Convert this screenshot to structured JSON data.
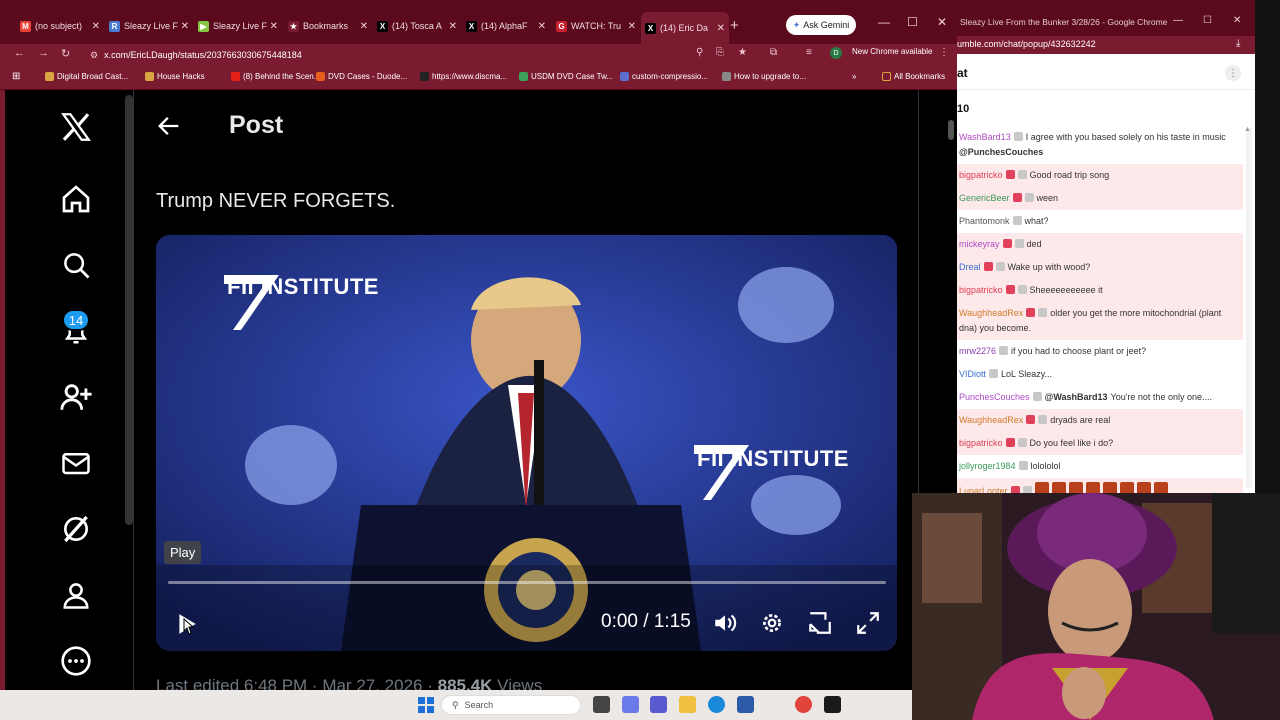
{
  "browser": {
    "tabs": [
      {
        "label": "(no subject)",
        "color": "#ea4335",
        "glyph": "M"
      },
      {
        "label": "Sleazy Live F",
        "color": "#4a7bd0",
        "glyph": "R"
      },
      {
        "label": "Sleazy Live F",
        "color": "#85c742",
        "glyph": "▶"
      },
      {
        "label": "Bookmarks",
        "color": "#7a1b2f",
        "glyph": "★"
      },
      {
        "label": "(14) Tosca A",
        "color": "#000000",
        "glyph": "X"
      },
      {
        "label": "(14) AlphaF",
        "color": "#000000",
        "glyph": "X"
      },
      {
        "label": "WATCH: Tru",
        "color": "#c6202e",
        "glyph": "G"
      },
      {
        "label": "(14) Eric Da",
        "color": "#000000",
        "glyph": "X"
      }
    ],
    "new_tab": "+",
    "gemini_label": "Ask Gemini",
    "url": "x.com/EricLDaugh/status/2037663030675448184",
    "new_chrome": "New Chrome available",
    "profile": "D",
    "bookmarks": [
      {
        "label": "Digital Broad Cast...",
        "color": "#d9a441"
      },
      {
        "label": "House Hacks",
        "color": "#d9a441"
      },
      {
        "label": "(8) Behind the Scen...",
        "color": "#e62117"
      },
      {
        "label": "DVD Cases - Duode...",
        "color": "#e85d1b"
      },
      {
        "label": "https://www.discma...",
        "color": "#222222"
      },
      {
        "label": "USDM DVD Case Tw...",
        "color": "#3aa05a"
      },
      {
        "label": "custom-compressio...",
        "color": "#5a6fd0"
      },
      {
        "label": "How to upgrade to...",
        "color": "#888888"
      }
    ],
    "bookmarks_more": "»",
    "all_bookmarks": "All Bookmarks"
  },
  "x": {
    "notifications_badge": "14",
    "header_title": "Post",
    "tweet_text": "Trump NEVER FORGETS.",
    "video": {
      "tooltip": "Play",
      "time": "0:00 / 1:15",
      "brand_text": "FII INSTITUTE",
      "progress": 0
    },
    "meta": {
      "edited": "Last edited 6:48 PM · Mar 27, 2026 · ",
      "views_count": "885.4K",
      "views_label": " Views"
    }
  },
  "chat_window": {
    "title": "Sleazy Live From the Bunker 3/28/26 - Google Chrome",
    "url": "umble.com/chat/popup/432632242",
    "header": "at",
    "count": "10",
    "messages": [
      {
        "user": "WashBard13",
        "color": "#b04bc4",
        "text": "I agree with you based solely on his taste in music",
        "mention": "@PunchesCouches",
        "hl": false
      },
      {
        "user": "bigpatricko",
        "color": "#e0405a",
        "text": "Good road trip song",
        "hl": true
      },
      {
        "user": "GenericBeer",
        "color": "#3a9a5a",
        "text": "ween",
        "hl": true
      },
      {
        "user": "Phantomonk",
        "color": "#555555",
        "text": "what?",
        "hl": false
      },
      {
        "user": "mickeyray",
        "color": "#b04bc4",
        "text": "ded",
        "hl": true
      },
      {
        "user": "Dreal",
        "color": "#3a6fd0",
        "text": "Wake up with wood?",
        "hl": true
      },
      {
        "user": "bigpatricko",
        "color": "#e0405a",
        "text": "Sheeeeeeeeeee it",
        "hl": true
      },
      {
        "user": "WaughheadRex",
        "color": "#d07a2a",
        "text": "older you get the more mitochondrial (plant dna) you become.",
        "hl": true
      },
      {
        "user": "mrw2276",
        "color": "#8a3ab0",
        "text": "if you had to choose plant or jeet?",
        "hl": false
      },
      {
        "user": "VIDiott",
        "color": "#3a6fd0",
        "text": "LoL Sleazy...",
        "hl": false
      },
      {
        "user": "PunchesCouches",
        "color": "#b04bc4",
        "text": "You're not the only one....",
        "mention": "@WashBard13",
        "hl": false
      },
      {
        "user": "WaughheadRex",
        "color": "#d07a2a",
        "text": "dryads are real",
        "hl": true
      },
      {
        "user": "bigpatricko",
        "color": "#e0405a",
        "text": "Do you feel like i do?",
        "hl": true
      },
      {
        "user": "jollyroger1984",
        "color": "#3a9a5a",
        "text": "lolololol",
        "hl": false
      },
      {
        "user": "LunarLooter",
        "color": "#d07a2a",
        "text": "",
        "hl": true
      }
    ]
  },
  "taskbar": {
    "search_placeholder": "Search"
  }
}
